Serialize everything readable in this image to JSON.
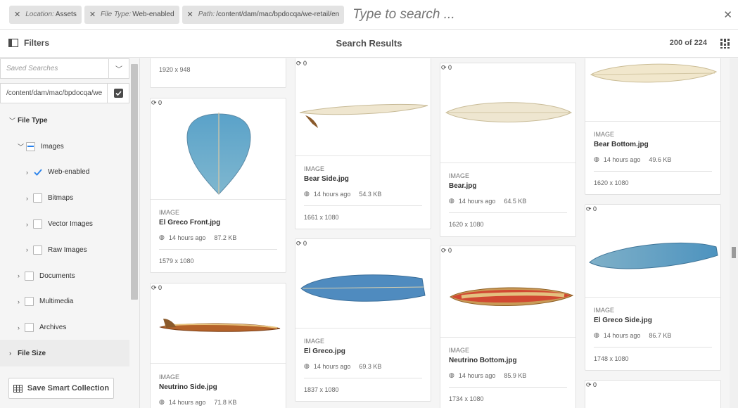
{
  "search": {
    "tags": [
      {
        "key": "Location:",
        "value": "Assets"
      },
      {
        "key": "File Type:",
        "value": "Web-enabled"
      },
      {
        "key": "Path:",
        "value": "/content/dam/mac/bpdocqa/we-retail/en"
      }
    ],
    "placeholder": "Type to search ..."
  },
  "header": {
    "filters_label": "Filters",
    "title": "Search Results",
    "count": "200 of 224"
  },
  "sidebar": {
    "saved_searches_placeholder": "Saved Searches",
    "path_value": "/content/dam/mac/bpdocqa/we",
    "file_type_label": "File Type",
    "images_label": "Images",
    "web_enabled_label": "Web-enabled",
    "bitmaps_label": "Bitmaps",
    "vector_images_label": "Vector Images",
    "raw_images_label": "Raw Images",
    "documents_label": "Documents",
    "multimedia_label": "Multimedia",
    "archives_label": "Archives",
    "file_size_label": "File Size",
    "save_smart_collection": "Save Smart Collection"
  },
  "cards": {
    "top_partial": {
      "dims": "1920 x 948"
    },
    "el_greco_front": {
      "sync": "0",
      "type": "IMAGE",
      "name": "El Greco Front.jpg",
      "time": "14 hours ago",
      "size": "87.2 KB",
      "dims": "1579 x 1080"
    },
    "bear_side": {
      "sync": "0",
      "type": "IMAGE",
      "name": "Bear Side.jpg",
      "time": "14 hours ago",
      "size": "54.3 KB",
      "dims": "1661 x 1080"
    },
    "bear": {
      "sync": "0",
      "type": "IMAGE",
      "name": "Bear.jpg",
      "time": "14 hours ago",
      "size": "64.5 KB",
      "dims": "1620 x 1080"
    },
    "bear_bottom": {
      "type": "IMAGE",
      "name": "Bear Bottom.jpg",
      "time": "14 hours ago",
      "size": "49.6 KB",
      "dims": "1620 x 1080"
    },
    "neutrino_side": {
      "sync": "0",
      "type": "IMAGE",
      "name": "Neutrino Side.jpg",
      "time": "14 hours ago",
      "size": "71.8 KB"
    },
    "el_greco": {
      "sync": "0",
      "type": "IMAGE",
      "name": "El Greco.jpg",
      "time": "14 hours ago",
      "size": "69.3 KB",
      "dims": "1837 x 1080"
    },
    "neutrino_bottom": {
      "sync": "0",
      "type": "IMAGE",
      "name": "Neutrino Bottom.jpg",
      "time": "14 hours ago",
      "size": "85.9 KB",
      "dims": "1734 x 1080"
    },
    "el_greco_side": {
      "sync": "0",
      "type": "IMAGE",
      "name": "El Greco Side.jpg",
      "time": "14 hours ago",
      "size": "86.7 KB",
      "dims": "1748 x 1080"
    },
    "bottom_partial": {
      "sync": "0"
    }
  }
}
